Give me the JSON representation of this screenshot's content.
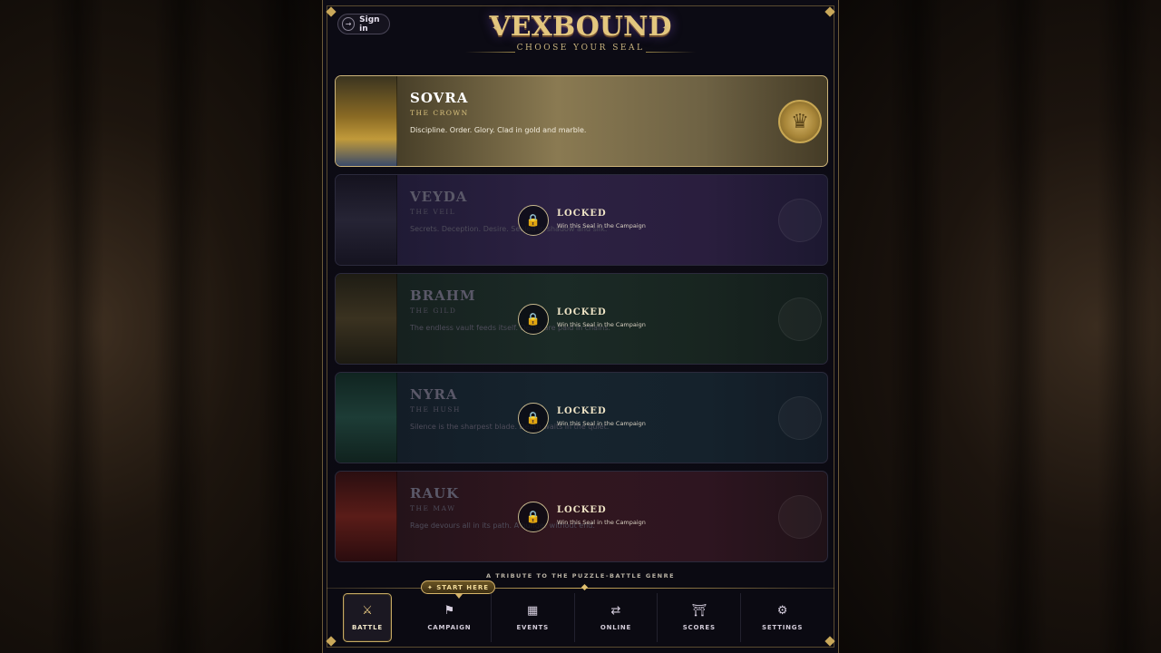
{
  "auth": {
    "sign_in_label": "Sign in"
  },
  "header": {
    "title": "VEXBOUND",
    "subtitle": "CHOOSE YOUR SEAL"
  },
  "seals": [
    {
      "name": "SOVRA",
      "epithet": "THE CROWN",
      "description": "Discipline. Order. Glory. Clad in gold and marble.",
      "locked": false
    },
    {
      "name": "VEYDA",
      "epithet": "THE VEIL",
      "description": "Secrets. Deception. Desire. Sealed in shadow and silk.",
      "locked": true
    },
    {
      "name": "BRAHM",
      "epithet": "THE GILD",
      "description": "The endless vault feeds itself. Debts are paid in chains.",
      "locked": true
    },
    {
      "name": "NYRA",
      "epithet": "THE HUSH",
      "description": "Silence is the sharpest blade. Death waits in the quiet.",
      "locked": true
    },
    {
      "name": "RAUK",
      "epithet": "THE MAW",
      "description": "Rage devours all in its path. A hunger without end.",
      "locked": true
    }
  ],
  "locked_overlay": {
    "label": "LOCKED",
    "hint": "Win this Seal in the Campaign"
  },
  "footer": {
    "tribute": "A TRIBUTE TO THE PUZZLE-BATTLE GENRE",
    "start_here": "✦ START HERE"
  },
  "nav": {
    "items": [
      {
        "label": "BATTLE",
        "icon": "sword-icon"
      },
      {
        "label": "CAMPAIGN",
        "icon": "flag-icon"
      },
      {
        "label": "EVENTS",
        "icon": "calendar-icon"
      },
      {
        "label": "ONLINE",
        "icon": "swap-icon"
      },
      {
        "label": "SCORES",
        "icon": "trophy-icon"
      },
      {
        "label": "SETTINGS",
        "icon": "gear-icon"
      }
    ],
    "active": "BATTLE"
  },
  "colors": {
    "accent_gold": "#c9a85a",
    "panel_bg": "#0c0b14"
  }
}
